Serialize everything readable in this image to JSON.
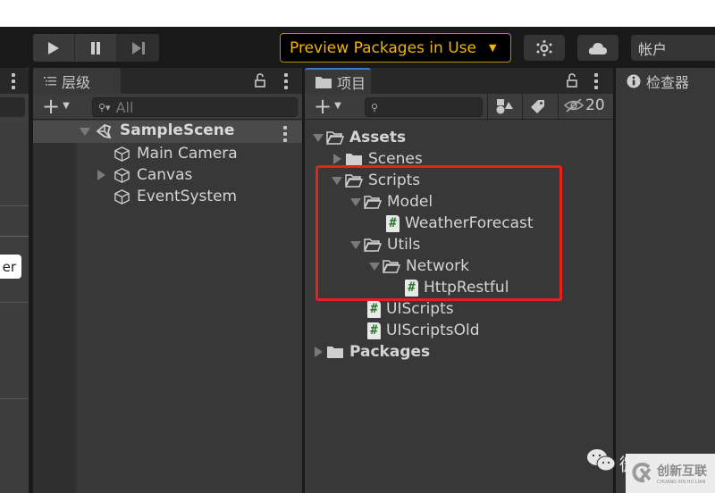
{
  "toolbar": {
    "play_label": "play",
    "pause_label": "pause",
    "step_label": "step",
    "preview_packages": "Preview Packages in Use",
    "account": "帐户"
  },
  "hierarchy": {
    "tab_label": "层级",
    "search_placeholder": "All",
    "scene": "SampleScene",
    "items": [
      {
        "label": "Main Camera",
        "expandable": false
      },
      {
        "label": "Canvas",
        "expandable": true
      },
      {
        "label": "EventSystem",
        "expandable": false
      }
    ]
  },
  "project": {
    "tab_label": "项目",
    "search_placeholder": "",
    "hidden_count": "20",
    "tree": [
      {
        "label": "Assets",
        "type": "folder-open",
        "state": "expanded",
        "depth": 0,
        "bold": true
      },
      {
        "label": "Scenes",
        "type": "folder",
        "state": "collapsed",
        "depth": 1
      },
      {
        "label": "Scripts",
        "type": "folder-open",
        "state": "expanded",
        "depth": 1
      },
      {
        "label": "Model",
        "type": "folder-open",
        "state": "expanded",
        "depth": 2
      },
      {
        "label": "WeatherForecast",
        "type": "script",
        "state": "none",
        "depth": 3
      },
      {
        "label": "Utils",
        "type": "folder-open",
        "state": "expanded",
        "depth": 2
      },
      {
        "label": "Network",
        "type": "folder-open",
        "state": "expanded",
        "depth": 3
      },
      {
        "label": "HttpRestful",
        "type": "script",
        "state": "none",
        "depth": 4
      },
      {
        "label": "UIScripts",
        "type": "script",
        "state": "none",
        "depth": 2
      },
      {
        "label": "UIScriptsOld",
        "type": "script",
        "state": "none",
        "depth": 2
      },
      {
        "label": "Packages",
        "type": "folder",
        "state": "collapsed",
        "depth": 0,
        "bold": true
      }
    ]
  },
  "inspector": {
    "tab_label": "检查器"
  },
  "left_panel": {
    "button_fragment": "er"
  },
  "watermark": {
    "brand": "创新互联",
    "sub": "CHUANG XIN HU LIAN",
    "wechat_fragment": "微"
  },
  "colors": {
    "highlight": "#e8201a",
    "preview_text": "#f0b500",
    "script_hash": "#2d7a2d",
    "active_tab_accent": "#3a79d0"
  }
}
